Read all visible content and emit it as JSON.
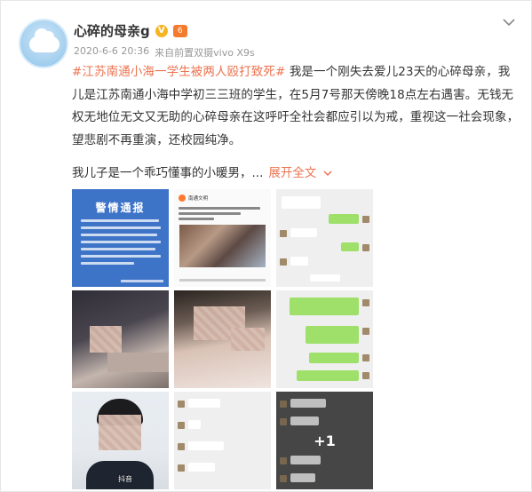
{
  "user": {
    "name": "心碎的母亲g",
    "vip_icon": "vip-v-icon",
    "level_icon": "level-badge-icon",
    "level_text": "6"
  },
  "meta": {
    "datetime": "2020-6-6 20:36",
    "source_prefix": "来自",
    "device": "前置双摄vivo X9s"
  },
  "menu_icon": "chevron-down-icon",
  "post": {
    "hashtag": "#江苏南通小海一学生被两人殴打致死#",
    "body": " 我是一个刚失去爱儿23天的心碎母亲，我儿是江苏南通小海中学初三三班的学生，在5月7号那天傍晚18点左右遇害。无钱无权无地位无文又无助的心碎母亲在这呼吁全社会都应引以为戒，重视这一社会现象，望悲剧不再重演，还校园纯净。",
    "second_line": "我儿子是一个乖巧懂事的小暖男，",
    "ellipsis": "...",
    "expand_label": "展开全文",
    "expand_icon": "chevron-down-icon"
  },
  "images": {
    "notice_title": "警情通报",
    "news_source": "南通文明",
    "tiktok_label": "抖音",
    "more_count": "+1"
  },
  "colors": {
    "accent": "#eb7350",
    "text": "#333333",
    "meta": "#999999",
    "notice_blue": "#3e74c8",
    "chat_green": "#9ee06a"
  }
}
